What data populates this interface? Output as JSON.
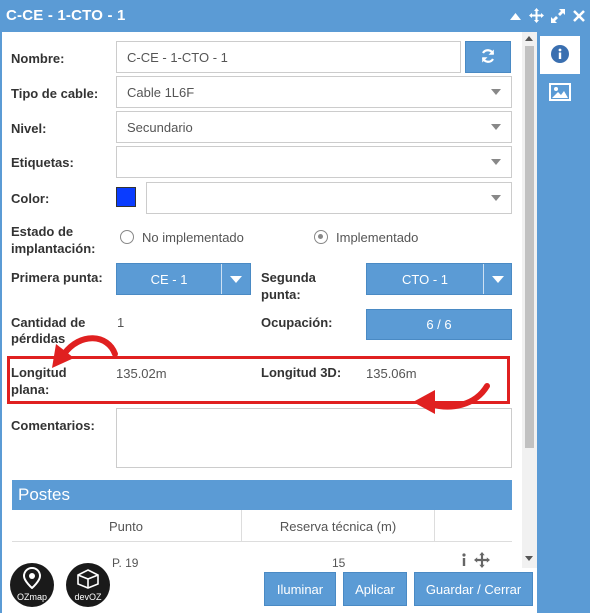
{
  "window": {
    "title": "C-CE - 1-CTO - 1",
    "title_icons": [
      "chevron-up-icon",
      "move-icon",
      "expand-icon",
      "close-icon"
    ]
  },
  "side_tabs": [
    "info-icon",
    "image-icon"
  ],
  "form": {
    "nombre": {
      "label": "Nombre:",
      "value": "C-CE - 1-CTO - 1"
    },
    "tipo_cable": {
      "label": "Tipo de cable:",
      "value": "Cable 1L6F"
    },
    "nivel": {
      "label": "Nivel:",
      "value": "Secundario"
    },
    "etiquetas": {
      "label": "Etiquetas:",
      "value": ""
    },
    "color": {
      "label": "Color:",
      "swatch": "#0a3cff",
      "value": ""
    },
    "estado": {
      "label_line1": "Estado de",
      "label_line2": "implantación:",
      "option1": "No implementado",
      "option2": "Implementado",
      "selected": "Implementado"
    },
    "primera_punta": {
      "label": "Primera punta:",
      "value": "CE - 1"
    },
    "segunda_punta": {
      "label_line1": "Segunda",
      "label_line2": "punta:",
      "value": "CTO - 1"
    },
    "cantidad_perdidas": {
      "label_line1": "Cantidad de",
      "label_line2": "pérdidas",
      "value": "1"
    },
    "ocupacion": {
      "label": "Ocupación:",
      "value": "6 / 6"
    },
    "longitud_plana": {
      "label_line1": "Longitud",
      "label_line2": "plana:",
      "value": "135.02m"
    },
    "longitud_3d": {
      "label": "Longitud 3D:",
      "value": "135.06m"
    },
    "comentarios": {
      "label": "Comentarios:",
      "value": ""
    }
  },
  "postes": {
    "title": "Postes",
    "columns": [
      "Punto",
      "Reserva técnica (m)"
    ],
    "rows": [
      {
        "punto": "P. 19",
        "reserva": "15"
      }
    ]
  },
  "footer": {
    "logos": [
      "OZmap",
      "devOZ"
    ],
    "buttons": {
      "iluminar": "Iluminar",
      "aplicar": "Aplicar",
      "guardar": "Guardar / Cerrar"
    }
  },
  "colors": {
    "accent": "#5b9bd5",
    "highlight": "#e02020"
  }
}
